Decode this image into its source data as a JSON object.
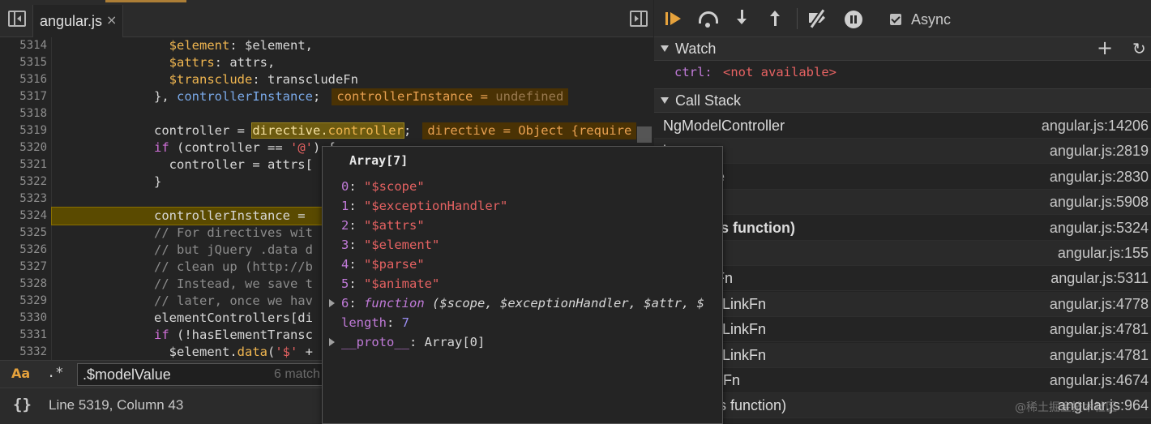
{
  "editor": {
    "tab": {
      "label": "angular.js",
      "close": "×"
    },
    "lines": [
      {
        "num": "5314",
        "html": "<span class=\"t\"></span>  <span class=\"c-prop\">$element</span>: $element,"
      },
      {
        "num": "5315",
        "html": "<span class=\"t\"></span>  <span class=\"c-prop\">$attrs</span>: attrs,"
      },
      {
        "num": "5316",
        "html": "<span class=\"t\"></span>  <span class=\"c-prop\">$transclude</span>: transcludeFn"
      },
      {
        "num": "5317",
        "html": "<span class=\"t\"></span>}, <span class=\"c-blue\">controllerInstance</span>;<span class=\"inline-val\">controllerInstance = <span class=\"u\">undefined</span></span>"
      },
      {
        "num": "5318",
        "html": ""
      },
      {
        "num": "5319",
        "html": "<span class=\"t\"></span>controller = <span class=\"sel\">directive.<span class=\"c-prop\">controller</span></span>;<span class=\"inline-val\">directive = Object {require</span>"
      },
      {
        "num": "5320",
        "html": "<span class=\"t\"></span><span class=\"c-kw\">if</span> (controller == <span class=\"c-str\">'@'</span>) {"
      },
      {
        "num": "5321",
        "html": "<span class=\"t\"></span>  controller = attrs["
      },
      {
        "num": "5322",
        "html": "<span class=\"t\"></span>}"
      },
      {
        "num": "5323",
        "html": ""
      },
      {
        "num": "5324",
        "html": "<span class=\"t\"></span>controllerInstance =",
        "highlight": true
      },
      {
        "num": "5325",
        "html": "<span class=\"t\"></span><span class=\"c-cm\">// For directives wit</span>"
      },
      {
        "num": "5326",
        "html": "<span class=\"t\"></span><span class=\"c-cm\">// but jQuery .data d</span>"
      },
      {
        "num": "5327",
        "html": "<span class=\"t\"></span><span class=\"c-cm\">// clean up (http://b</span>"
      },
      {
        "num": "5328",
        "html": "<span class=\"t\"></span><span class=\"c-cm\">// Instead, we save t</span>"
      },
      {
        "num": "5329",
        "html": "<span class=\"t\"></span><span class=\"c-cm\">// later, once we hav</span>"
      },
      {
        "num": "5330",
        "html": "<span class=\"t\"></span>elementControllers[di"
      },
      {
        "num": "5331",
        "html": "<span class=\"t\"></span><span class=\"c-kw\">if</span> (!hasElementTransc"
      },
      {
        "num": "5332",
        "html": "<span class=\"t\"></span>  $element.<span class=\"c-prop\">data</span>(<span class=\"c-str\">'$'</span> +"
      }
    ]
  },
  "search": {
    "case_label": "Aa",
    "regex_label": ".*",
    "value": ".$modelValue",
    "count": "6 match"
  },
  "status": {
    "format_icon": "{}",
    "position": "Line 5319, Column 43"
  },
  "popover": {
    "title": "Array[7]",
    "items": [
      {
        "key": "0",
        "value": "\"$scope\""
      },
      {
        "key": "1",
        "value": "\"$exceptionHandler\""
      },
      {
        "key": "2",
        "value": "\"$attrs\""
      },
      {
        "key": "3",
        "value": "\"$element\""
      },
      {
        "key": "4",
        "value": "\"$parse\""
      },
      {
        "key": "5",
        "value": "\"$animate\""
      }
    ],
    "fn_item": {
      "key": "6",
      "keyword": "function",
      "args": "($scope, $exceptionHandler, $attr, $"
    },
    "length_key": "length",
    "length_value": "7",
    "proto_key": "__proto__",
    "proto_value": "Array[0]"
  },
  "debugger": {
    "async_label": "Async",
    "watch": {
      "title": "Watch",
      "add": "+",
      "refresh": "↻",
      "expr": "ctrl:",
      "value": "<not available>"
    },
    "callstack": {
      "title": "Call Stack",
      "frames": [
        {
          "fn": "NgModelController",
          "loc": "angular.js:14206",
          "bold": false
        },
        {
          "fn": "i",
          "loc": "angular.js:2819",
          "bold": false
        },
        {
          "fn": "e",
          "loc": "angular.js:2830",
          "bold": false
        },
        {
          "fn": "",
          "loc": "angular.js:5908",
          "bold": false
        },
        {
          "fn": "ous function)",
          "loc": "angular.js:5324",
          "bold": true
        },
        {
          "fn": "",
          "loc": "angular.js:155",
          "bold": false
        },
        {
          "fn": "Fn",
          "loc": "angular.js:5311",
          "bold": false
        },
        {
          "fn": "eLinkFn",
          "loc": "angular.js:4778",
          "bold": false
        },
        {
          "fn": "eLinkFn",
          "loc": "angular.js:4781",
          "bold": false
        },
        {
          "fn": "eLinkFn",
          "loc": "angular.js:4781",
          "bold": false
        },
        {
          "fn": "kFn",
          "loc": "angular.js:4674",
          "bold": false
        },
        {
          "fn": "ous function)",
          "loc": "angular.js:964",
          "bold": false
        }
      ]
    }
  },
  "watermark": "@稀土掘金技术社区"
}
